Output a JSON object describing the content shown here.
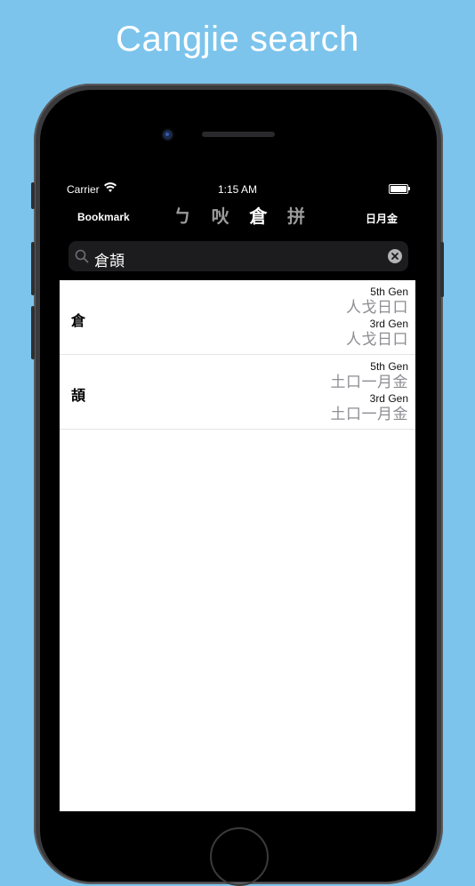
{
  "headline": "Cangjie search",
  "status": {
    "carrier": "Carrier",
    "time": "1:15 AM"
  },
  "nav": {
    "left": "Bookmark",
    "tabs": [
      {
        "label": "ㄅ",
        "active": false
      },
      {
        "label": "吙",
        "active": false
      },
      {
        "label": "倉",
        "active": true
      },
      {
        "label": "拼",
        "active": false
      }
    ],
    "right": "日月金"
  },
  "search": {
    "value": "倉頡"
  },
  "results": [
    {
      "char": "倉",
      "gen5_label": "5th Gen",
      "gen5_code": "人戈日口",
      "gen3_label": "3rd Gen",
      "gen3_code": "人戈日口"
    },
    {
      "char": "頡",
      "gen5_label": "5th Gen",
      "gen5_code": "土口一月金",
      "gen3_label": "3rd Gen",
      "gen3_code": "土口一月金"
    }
  ],
  "colors": {
    "background": "#7cc4ec",
    "screen": "#000000",
    "list": "#ffffff",
    "code": "#8e8e93"
  }
}
